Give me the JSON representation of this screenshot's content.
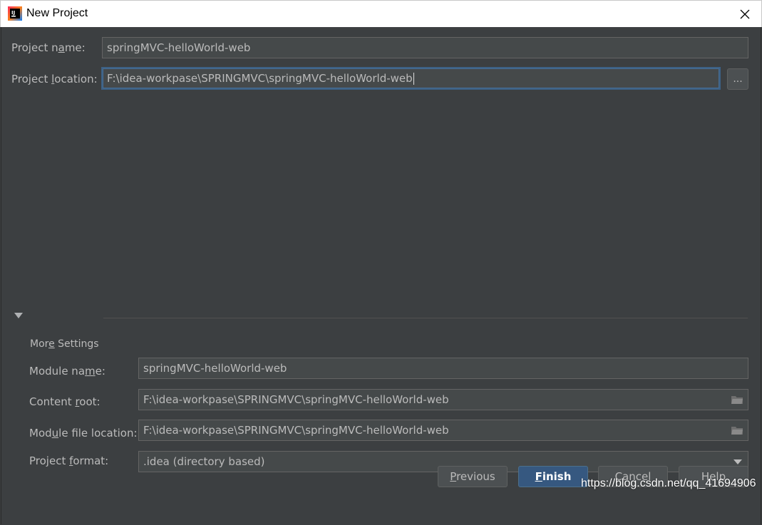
{
  "window": {
    "title": "New Project",
    "app_icon": "intellij-idea-icon",
    "close_icon": "close-icon"
  },
  "form": {
    "project_name": {
      "label": "Project name:",
      "value": "springMVC-helloWorld-web"
    },
    "project_location": {
      "label": "Project location:",
      "value": "F:\\idea-workpase\\SPRINGMVC\\springMVC-helloWorld-web",
      "browse_label": "..."
    }
  },
  "more_settings": {
    "title": "More Settings",
    "expanded": true,
    "module_name": {
      "label": "Module name:",
      "value": "springMVC-helloWorld-web"
    },
    "content_root": {
      "label": "Content root:",
      "value": "F:\\idea-workpase\\SPRINGMVC\\springMVC-helloWorld-web"
    },
    "module_file_location": {
      "label": "Module file location:",
      "value": "F:\\idea-workpase\\SPRINGMVC\\springMVC-helloWorld-web"
    },
    "project_format": {
      "label": "Project format:",
      "value": ".idea (directory based)"
    }
  },
  "buttons": {
    "previous": "Previous",
    "finish": "Finish",
    "cancel": "Cancel",
    "help": "Help"
  },
  "watermark": "https://blog.csdn.net/qq_41694906",
  "colors": {
    "background": "#3c3f41",
    "field_bg": "#45494a",
    "focus_border": "#3d6185",
    "primary_button": "#365880",
    "text": "#bbbbbb"
  }
}
